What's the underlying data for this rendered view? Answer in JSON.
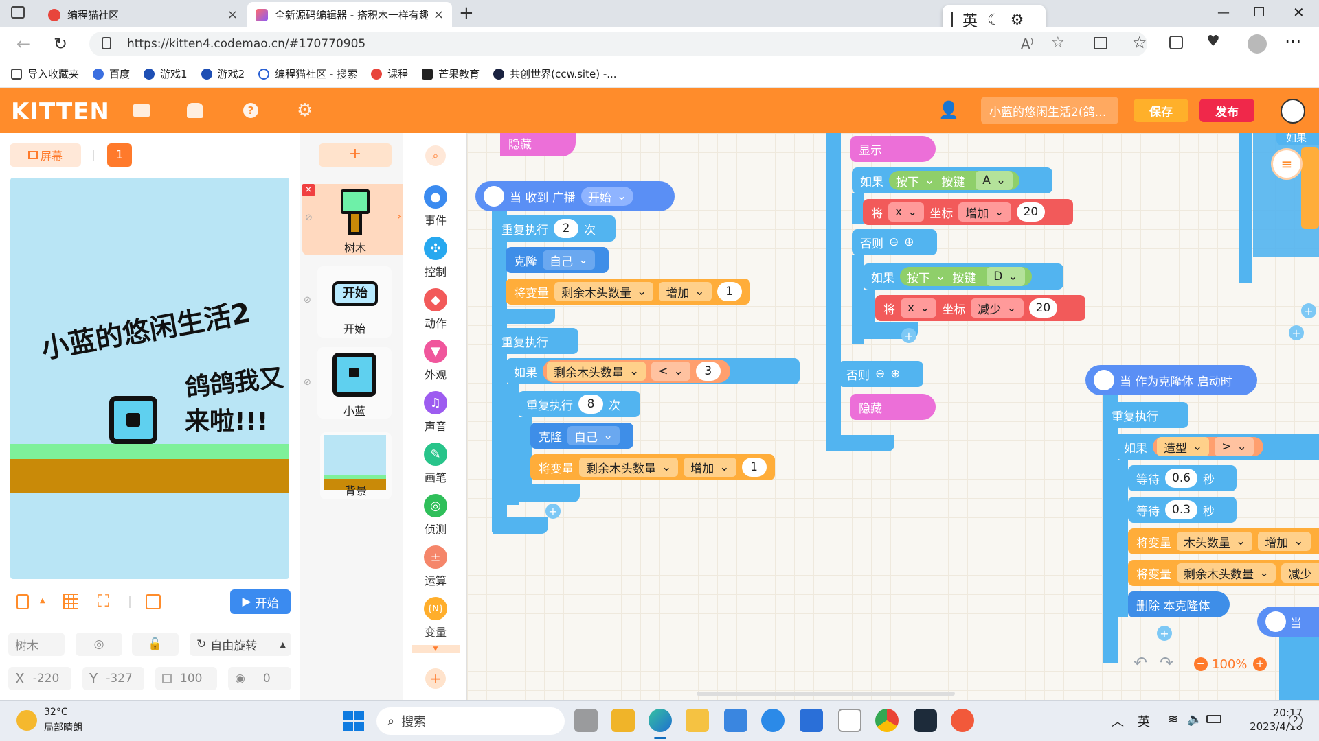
{
  "browser": {
    "tabs": [
      {
        "title": "编程猫社区"
      },
      {
        "title": "全新源码编辑器 - 搭积木一样有趣"
      }
    ],
    "url": "https://kitten4.codemao.cn/#170770905",
    "ime": {
      "lang": "英"
    },
    "bookmarks": [
      "导入收藏夹",
      "百度",
      "游戏1",
      "游戏2",
      "编程猫社区 - 搜索",
      "课程",
      "芒果教育",
      "共创世界(ccw.site) -..."
    ]
  },
  "header": {
    "logo": "KITTEN",
    "project": "小蓝的悠闲生活2(鸽…",
    "save": "保存",
    "publish": "发布"
  },
  "stage": {
    "screen_btn": "屏幕",
    "screen_num": "1",
    "title_line1": "小蓝的悠闲生活2",
    "title_line2": "鸽鸽我又",
    "title_line3": "来啦!!!",
    "start": "开始"
  },
  "props": {
    "name": "树木",
    "rotate": "自由旋转",
    "x_label": "X",
    "x": "-220",
    "y_label": "Y",
    "y": "-327",
    "size": "100",
    "dir": "0"
  },
  "sprites": {
    "add": "+",
    "items": [
      "树木",
      "开始",
      "小蓝",
      "背景"
    ],
    "start_label": "开始"
  },
  "categories": [
    "事件",
    "控制",
    "动作",
    "外观",
    "声音",
    "画笔",
    "侦测",
    "运算",
    "变量"
  ],
  "blocks": {
    "hide": "隐藏",
    "show": "显示",
    "when_broadcast": "当 收到 广播",
    "broadcast_val": "开始",
    "repeat": "重复执行",
    "times": "次",
    "clone": "克隆",
    "self": "自己",
    "set_var": "将变量",
    "var_name": "剩余木头数量",
    "var_name2": "木头数量",
    "add": "增加",
    "reduce": "减少",
    "if": "如果",
    "else": "否则",
    "press": "按下",
    "key": "按键",
    "keyA": "A",
    "keyD": "D",
    "will": "将",
    "x": "x",
    "coord": "坐标",
    "lt": "<",
    "gt": ">",
    "num1": "1",
    "num2": "2",
    "num3": "3",
    "num8": "8",
    "num20": "20",
    "when_clone": "当 作为克隆体 启动时",
    "costume": "造型",
    "wait": "等待",
    "sec": "秒",
    "w1": "0.6",
    "w2": "0.3",
    "delete_clone": "删除 本克隆体",
    "partial_if": "如果",
    "partial_when": "当"
  },
  "zoom": "100%",
  "taskbar": {
    "weather_temp": "32°C",
    "weather_desc": "局部晴朗",
    "search": "搜索",
    "lang": "英",
    "time": "20:17",
    "date": "2023/4/18",
    "notif": "2"
  }
}
